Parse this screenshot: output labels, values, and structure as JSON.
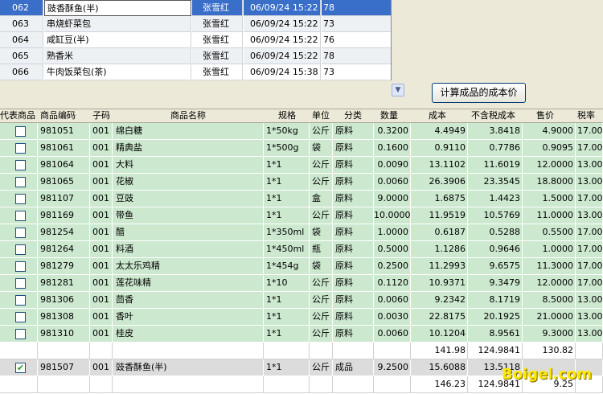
{
  "top_list": {
    "rows": [
      {
        "code": "062",
        "name": "豉香酥鱼(半)",
        "user": "张雪红",
        "time": "06/09/24 15:22",
        "num": "78",
        "selected": true
      },
      {
        "code": "063",
        "name": "串烧虾菜包",
        "user": "张雪红",
        "time": "06/09/24 15:22",
        "num": "73"
      },
      {
        "code": "064",
        "name": "咸缸豆(半)",
        "user": "张雪红",
        "time": "06/09/24 15:22",
        "num": "76"
      },
      {
        "code": "065",
        "name": "熟香米",
        "user": "张雪红",
        "time": "06/09/24 15:22",
        "num": "78"
      },
      {
        "code": "066",
        "name": "牛肉饭菜包(茶)",
        "user": "张雪红",
        "time": "06/09/24 15:38",
        "num": "73"
      }
    ]
  },
  "calc_button_label": "计算成品的成本价",
  "grid": {
    "headers": [
      "代表商品",
      "商品编码",
      "子码",
      "商品名称",
      "规格",
      "单位",
      "分类",
      "数量",
      "成本",
      "不含税成本",
      "售价",
      "税率"
    ],
    "rows": [
      {
        "code": "981051",
        "sub": "001",
        "name": "绵白糖",
        "spec": "1*50kg",
        "unit": "公斤",
        "cat": "原料",
        "qty": "0.3200",
        "cost": "4.4949",
        "cost_ex": "3.8418",
        "price": "4.9000",
        "tax": "17.00"
      },
      {
        "code": "981061",
        "sub": "001",
        "name": "精典盐",
        "spec": "1*500g",
        "unit": "袋",
        "cat": "原料",
        "qty": "0.1600",
        "cost": "0.9110",
        "cost_ex": "0.7786",
        "price": "0.9095",
        "tax": "17.00"
      },
      {
        "code": "981064",
        "sub": "001",
        "name": "大料",
        "spec": "1*1",
        "unit": "公斤",
        "cat": "原料",
        "qty": "0.0090",
        "cost": "13.1102",
        "cost_ex": "11.6019",
        "price": "12.0000",
        "tax": "13.00"
      },
      {
        "code": "981065",
        "sub": "001",
        "name": "花椒",
        "spec": "1*1",
        "unit": "公斤",
        "cat": "原料",
        "qty": "0.0060",
        "cost": "26.3906",
        "cost_ex": "23.3545",
        "price": "18.8000",
        "tax": "13.00"
      },
      {
        "code": "981107",
        "sub": "001",
        "name": "豆豉",
        "spec": "1*1",
        "unit": "盒",
        "cat": "原料",
        "qty": "9.0000",
        "cost": "1.6875",
        "cost_ex": "1.4423",
        "price": "1.5000",
        "tax": "17.00"
      },
      {
        "code": "981169",
        "sub": "001",
        "name": "带鱼",
        "spec": "1*1",
        "unit": "公斤",
        "cat": "原料",
        "qty": "10.0000",
        "cost": "11.9519",
        "cost_ex": "10.5769",
        "price": "11.0000",
        "tax": "13.00"
      },
      {
        "code": "981254",
        "sub": "001",
        "name": "醋",
        "spec": "1*350ml",
        "unit": "袋",
        "cat": "原料",
        "qty": "1.0000",
        "cost": "0.6187",
        "cost_ex": "0.5288",
        "price": "0.5500",
        "tax": "17.00"
      },
      {
        "code": "981264",
        "sub": "001",
        "name": "料酒",
        "spec": "1*450ml",
        "unit": "瓶",
        "cat": "原料",
        "qty": "0.5000",
        "cost": "1.1286",
        "cost_ex": "0.9646",
        "price": "1.0000",
        "tax": "17.00"
      },
      {
        "code": "981279",
        "sub": "001",
        "name": "太太乐鸡精",
        "spec": "1*454g",
        "unit": "袋",
        "cat": "原料",
        "qty": "0.2500",
        "cost": "11.2993",
        "cost_ex": "9.6575",
        "price": "11.3000",
        "tax": "17.00"
      },
      {
        "code": "981281",
        "sub": "001",
        "name": "莲花味精",
        "spec": "1*10",
        "unit": "公斤",
        "cat": "原料",
        "qty": "0.1120",
        "cost": "10.9371",
        "cost_ex": "9.3479",
        "price": "12.0000",
        "tax": "17.00"
      },
      {
        "code": "981306",
        "sub": "001",
        "name": "茴香",
        "spec": "1*1",
        "unit": "公斤",
        "cat": "原料",
        "qty": "0.0060",
        "cost": "9.2342",
        "cost_ex": "8.1719",
        "price": "8.5000",
        "tax": "13.00"
      },
      {
        "code": "981308",
        "sub": "001",
        "name": "香叶",
        "spec": "1*1",
        "unit": "公斤",
        "cat": "原料",
        "qty": "0.0030",
        "cost": "22.8175",
        "cost_ex": "20.1925",
        "price": "21.0000",
        "tax": "13.00"
      },
      {
        "code": "981310",
        "sub": "001",
        "name": "桂皮",
        "spec": "1*1",
        "unit": "公斤",
        "cat": "原料",
        "qty": "0.0060",
        "cost": "10.1204",
        "cost_ex": "8.9561",
        "price": "9.3000",
        "tax": "13.00"
      }
    ],
    "subtotal": {
      "cost": "141.98",
      "cost_ex": "124.9841",
      "price": "130.82"
    },
    "product": {
      "code": "981507",
      "sub": "001",
      "name": "豉香酥鱼(半)",
      "spec": "1*1",
      "unit": "公斤",
      "cat": "成品",
      "qty": "9.2500",
      "cost": "15.6088",
      "cost_ex": "13.5118",
      "price": "",
      "tax": "",
      "checked": true
    },
    "total": {
      "cost": "146.23",
      "cost_ex": "124.9841",
      "price": "9.25"
    }
  },
  "watermark": "Boigel.com"
}
